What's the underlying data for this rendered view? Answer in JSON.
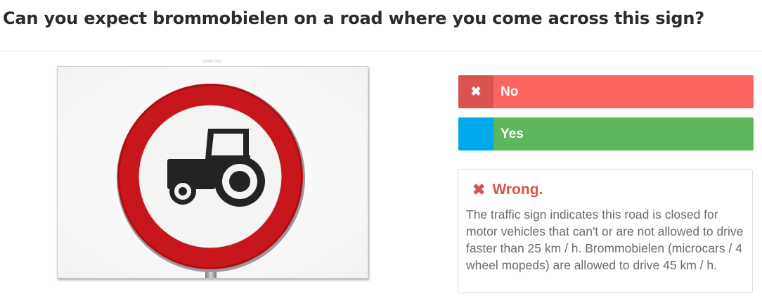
{
  "question": "Can you expect brommobielen on a road where you come across this sign?",
  "image": {
    "credit": "STWN 2020",
    "sign_icon": "no-agricultural-vehicles-sign",
    "colors": {
      "ring": "#c8161d",
      "center": "#f4f4f2",
      "symbol": "#232323"
    }
  },
  "answers": [
    {
      "label": "No",
      "icon": "close-icon",
      "state": "selected-wrong",
      "mark_color": "#d9534f",
      "color": "#ff6560"
    },
    {
      "label": "Yes",
      "icon": "",
      "state": "correct",
      "mark_color": "#00aaea",
      "color": "#5cb85c"
    }
  ],
  "feedback": {
    "icon": "close-icon",
    "title": "Wrong.",
    "text": "The traffic sign indicates this road is closed for motor vehicles that can't or are not allowed to drive faster than 25 km / h. Brommobielen (microcars / 4 wheel mopeds) are allowed to drive 45 km / h.",
    "color": "#d9534f"
  }
}
